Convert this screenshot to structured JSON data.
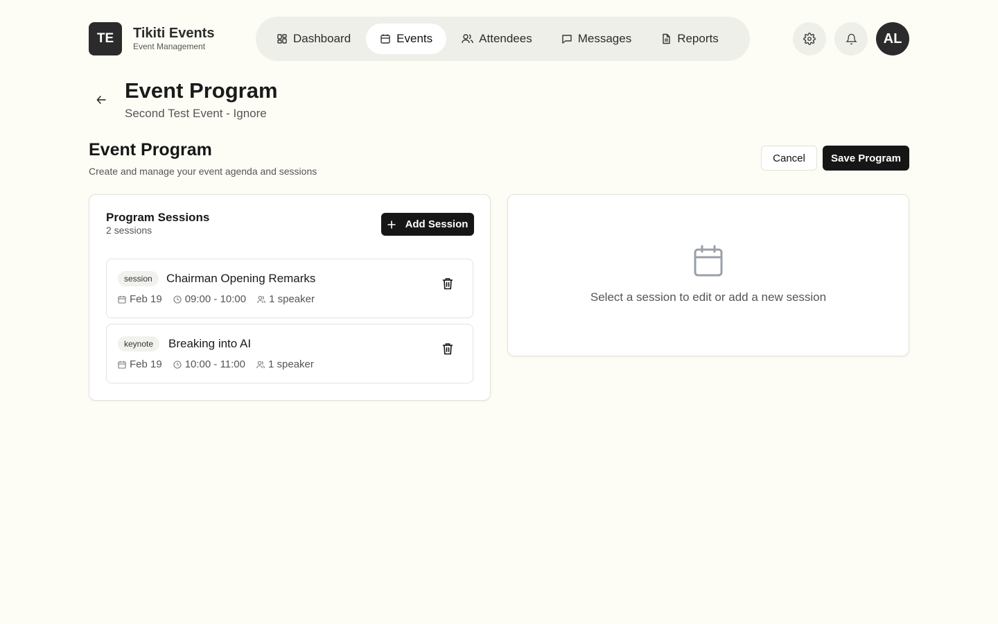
{
  "brand": {
    "logo": "TE",
    "name": "Tikiti Events",
    "subtitle": "Event Management"
  },
  "nav": [
    {
      "label": "Dashboard",
      "icon": "dashboard-icon",
      "active": false
    },
    {
      "label": "Events",
      "icon": "calendar-icon",
      "active": true
    },
    {
      "label": "Attendees",
      "icon": "users-icon",
      "active": false
    },
    {
      "label": "Messages",
      "icon": "message-icon",
      "active": false
    },
    {
      "label": "Reports",
      "icon": "file-icon",
      "active": false
    }
  ],
  "header_actions": {
    "settings_icon": "gear-icon",
    "notifications_icon": "bell-icon",
    "avatar": "AL"
  },
  "page": {
    "title": "Event Program",
    "subtitle": "Second Test Event - Ignore"
  },
  "section": {
    "title": "Event Program",
    "subtitle": "Create and manage your event agenda and sessions",
    "cancel_label": "Cancel",
    "save_label": "Save Program"
  },
  "sessions_panel": {
    "title": "Program Sessions",
    "count": "2 sessions",
    "add_label": "Add Session",
    "sessions": [
      {
        "type": "session",
        "title": "Chairman Opening Remarks",
        "date": "Feb 19",
        "time": "09:00 - 10:00",
        "speakers": "1 speaker"
      },
      {
        "type": "keynote",
        "title": "Breaking into AI",
        "date": "Feb 19",
        "time": "10:00 - 11:00",
        "speakers": "1 speaker"
      }
    ]
  },
  "editor_panel": {
    "empty_text": "Select a session to edit or add a new session",
    "icon": "calendar-icon"
  },
  "colors": {
    "background": "#fdfdf6",
    "primary": "#161616",
    "nav_bg": "#efefea",
    "border": "#e2e2dc"
  }
}
